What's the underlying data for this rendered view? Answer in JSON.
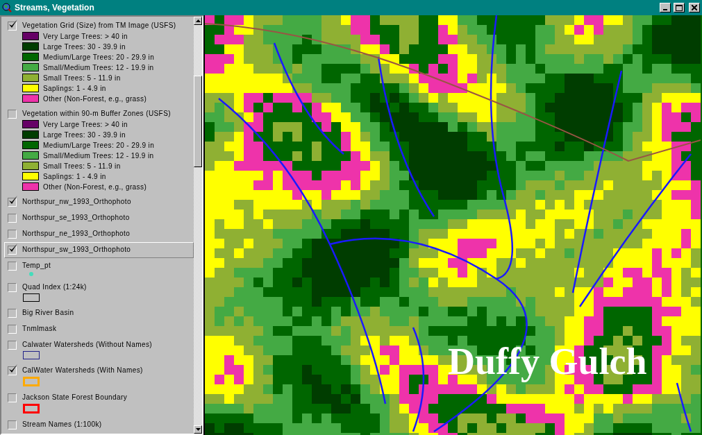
{
  "window": {
    "title": "Streams, Vegetation"
  },
  "layers": [
    {
      "name": "Vegetation Grid (Size) from TM Image (USFS)",
      "kind": "classes",
      "visible": true,
      "selected": false,
      "classes": [
        {
          "label": "Very Large Trees: > 40  in",
          "color": "#660066"
        },
        {
          "label": "Large Trees: 30 - 39.9 in",
          "color": "#003d00"
        },
        {
          "label": "Medium/Large Trees: 20 - 29.9 in",
          "color": "#006600"
        },
        {
          "label": "Small/Medium Trees: 12 - 19.9 in",
          "color": "#44aa44"
        },
        {
          "label": "Small Trees: 5 - 11.9 in",
          "color": "#8fb033"
        },
        {
          "label": "Saplings: 1 - 4.9 in",
          "color": "#ffff00"
        },
        {
          "label": "Other (Non-Forest, e.g., grass)",
          "color": "#ee33aa"
        }
      ]
    },
    {
      "name": "Vegetation within 90-m Buffer Zones (USFS)",
      "kind": "classes",
      "visible": false,
      "selected": false,
      "classes": [
        {
          "label": "Very Large Trees: > 40  in",
          "color": "#660066"
        },
        {
          "label": "Large Trees: 30 - 39.9 in",
          "color": "#003d00"
        },
        {
          "label": "Medium/Large Trees: 20 - 29.9 in",
          "color": "#006600"
        },
        {
          "label": "Small/Medium Trees: 12 - 19.9 in",
          "color": "#44aa44"
        },
        {
          "label": "Small Trees: 5 - 11.9 in",
          "color": "#8fb033"
        },
        {
          "label": "Saplings: 1 - 4.9 in",
          "color": "#ffff00"
        },
        {
          "label": "Other (Non-Forest, e.g., grass)",
          "color": "#ee33aa"
        }
      ]
    },
    {
      "name": "Northspur_nw_1993_Orthophoto",
      "kind": "plain",
      "visible": true,
      "selected": false
    },
    {
      "name": "Northspur_se_1993_Orthophoto",
      "kind": "plain",
      "visible": false,
      "selected": false
    },
    {
      "name": "Northspur_ne_1993_Orthophoto",
      "kind": "plain",
      "visible": false,
      "selected": false
    },
    {
      "name": "Northspur_sw_1993_Orthophoto",
      "kind": "plain",
      "visible": true,
      "selected": true
    },
    {
      "name": "Temp_pt",
      "kind": "point",
      "visible": false,
      "selected": false,
      "color": "#44ddbb"
    },
    {
      "name": "Quad Index (1:24k)",
      "kind": "outline",
      "visible": false,
      "selected": false,
      "color": "#000000"
    },
    {
      "name": "Big River Basin",
      "kind": "plain",
      "visible": false,
      "selected": false
    },
    {
      "name": "Tnmlmask",
      "kind": "plain",
      "visible": false,
      "selected": false
    },
    {
      "name": "Calwater Watersheds (Without Names)",
      "kind": "outline",
      "visible": false,
      "selected": false,
      "color": "#222288"
    },
    {
      "name": "CalWater Watersheds (With Names)",
      "kind": "outline",
      "visible": true,
      "selected": false,
      "color": "#ffaa00"
    },
    {
      "name": "Jackson State Forest Boundary",
      "kind": "outline",
      "visible": false,
      "selected": false,
      "color": "#ff0000"
    },
    {
      "name": "Stream Names (1:100k)",
      "kind": "plain",
      "visible": false,
      "selected": false
    }
  ],
  "map": {
    "label": "Duffy Gulch"
  }
}
